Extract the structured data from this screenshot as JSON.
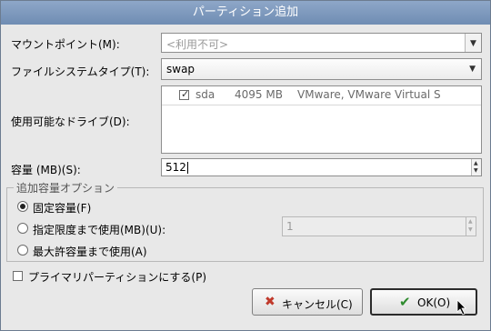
{
  "window": {
    "title": "パーティション追加"
  },
  "form": {
    "mount_point": {
      "label": "マウントポイント(M):",
      "value": "<利用不可>"
    },
    "filesystem": {
      "label": "ファイルシステムタイプ(T):",
      "value": "swap"
    },
    "drives": {
      "label": "使用可能なドライブ(D):",
      "items": [
        {
          "checked": true,
          "name": "sda",
          "size": "4095 MB",
          "model": "VMware, VMware Virtual S"
        }
      ]
    },
    "size": {
      "label": "容量 (MB)(S):",
      "value": "512"
    },
    "options": {
      "title": "追加容量オプション",
      "fixed": {
        "label": "固定容量(F)",
        "selected": true
      },
      "fill_limit": {
        "label": "指定限度まで使用(MB)(U):",
        "value": "1",
        "selected": false
      },
      "fill_max": {
        "label": "最大許容量まで使用(A)",
        "selected": false
      }
    },
    "primary": {
      "label": "プライマリパーティションにする(P)",
      "checked": false
    }
  },
  "buttons": {
    "cancel": {
      "label": "キャンセル(C)",
      "icon": "cancel-x-icon",
      "color": "#c0392b"
    },
    "ok": {
      "label": "OK(O)",
      "icon": "checkmark-icon",
      "color": "#2e8b2e"
    }
  }
}
